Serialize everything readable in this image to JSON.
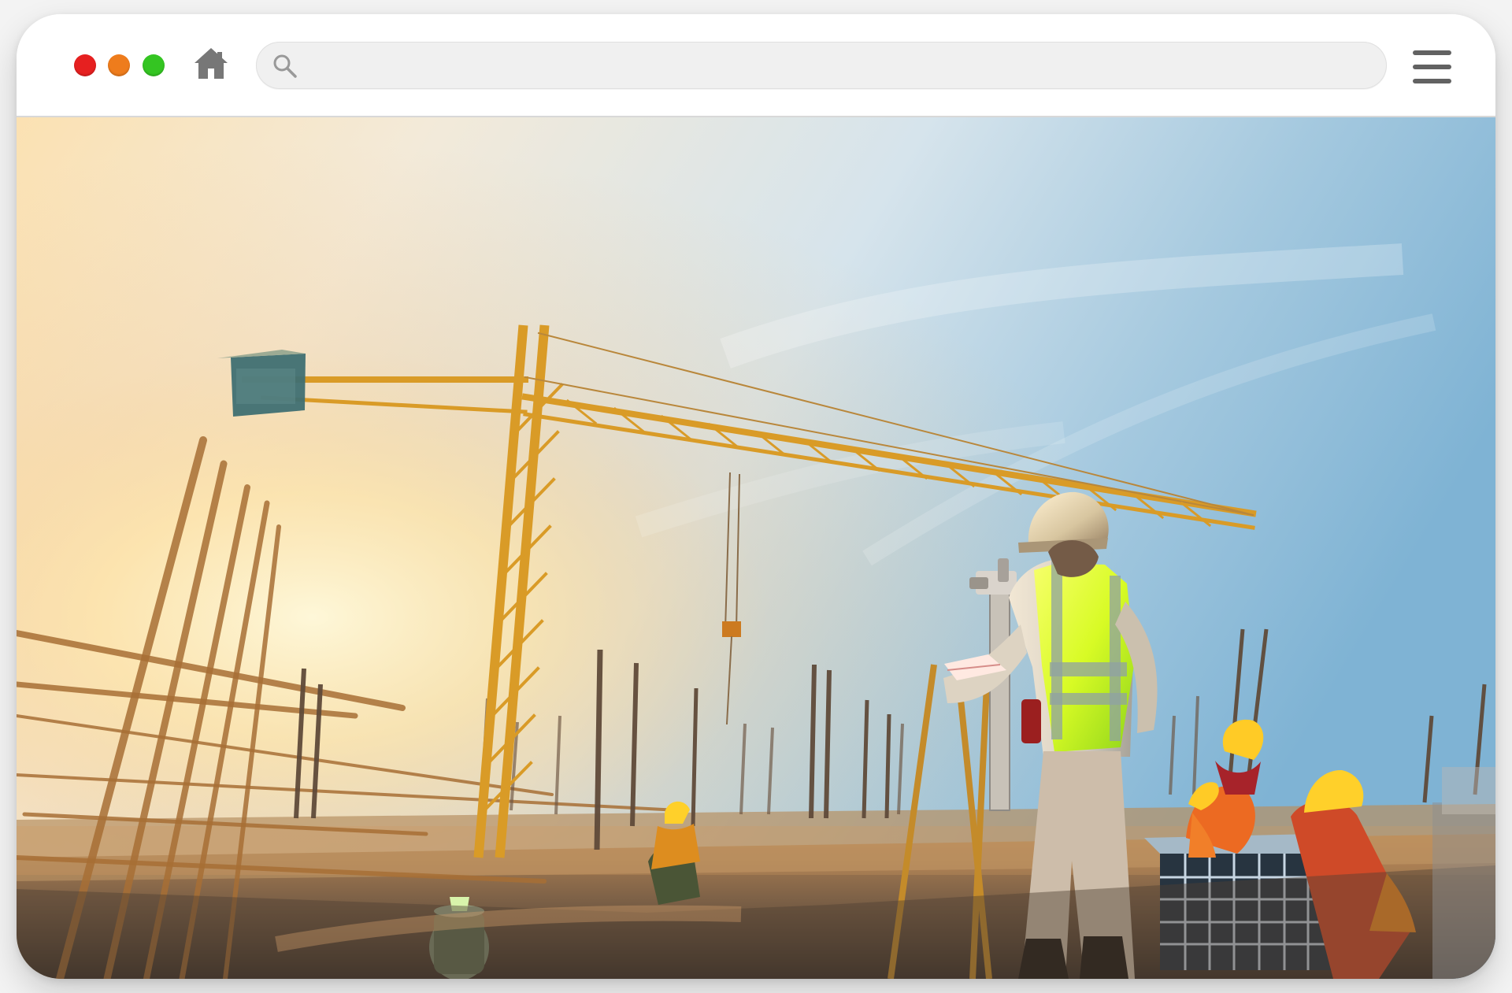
{
  "browser": {
    "window_controls": [
      {
        "name": "close",
        "color": "#e62020"
      },
      {
        "name": "minimize",
        "color": "#ee7c1c"
      },
      {
        "name": "maximize",
        "color": "#34c522"
      }
    ],
    "home_icon": "home-icon",
    "search_icon": "search-icon",
    "menu_icon": "menu-icon",
    "address_bar": {
      "value": "",
      "placeholder": ""
    }
  },
  "content": {
    "image": {
      "kind": "construction site photograph"
    }
  },
  "colors": {
    "toolbar_background": "#ffffff",
    "address_bar_background": "#f0f0f0",
    "menu_icon": "#626262",
    "home_icon": "#777777",
    "crane": "#e8a22e",
    "hard_hat": "#f2c23c",
    "safety_vest": "#d7ff24",
    "sky_blue": "#86b7d6",
    "sunlight": "#f9dba7"
  }
}
